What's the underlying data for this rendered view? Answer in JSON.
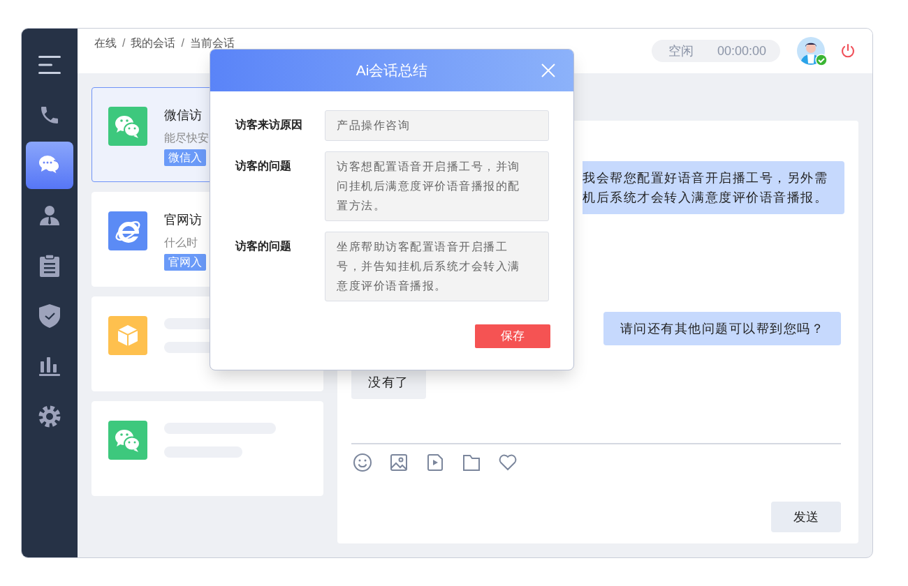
{
  "sidebar": {
    "items": [
      {
        "kind": "menu",
        "selected": false
      },
      {
        "kind": "phone",
        "selected": false
      },
      {
        "kind": "chat",
        "selected": true
      },
      {
        "kind": "person",
        "selected": false
      },
      {
        "kind": "clipboard",
        "selected": false
      },
      {
        "kind": "shield",
        "selected": false
      },
      {
        "kind": "chart",
        "selected": false
      },
      {
        "kind": "settings",
        "selected": false
      }
    ]
  },
  "breadcrumb": [
    {
      "kind": "link",
      "text": "在线"
    },
    {
      "kind": "separator",
      "text": "/"
    },
    {
      "kind": "link",
      "text": "我的会话"
    },
    {
      "kind": "separator",
      "text": "/"
    },
    {
      "kind": "link",
      "text": "当前会话"
    }
  ],
  "agent_status": {
    "state": "空闲",
    "timer": "00:00:00",
    "online": true
  },
  "sessions": [
    {
      "kind": "wechat",
      "title": "微信访",
      "preview": "能尽快安",
      "tag": "微信入",
      "selected": true
    },
    {
      "kind": "browser",
      "title": "官网访",
      "preview": "什么时",
      "tag": "官网入",
      "selected": false
    },
    {
      "kind": "package",
      "loading": true,
      "selected": false
    },
    {
      "kind": "wechat",
      "loading": true,
      "selected": false
    }
  ],
  "messages": [
    {
      "kind": "sent",
      "lines": [
        "我会帮您配置好语音开启播工号，另外需",
        "机后系统才会转入满意度评价语音播报。"
      ]
    },
    {
      "kind": "sent",
      "lines": [
        "请问还有其他问题可以帮到您吗？"
      ]
    },
    {
      "kind": "received",
      "lines": [
        "没有了"
      ]
    }
  ],
  "send_button": "发送",
  "modal": {
    "title": "Ai会话总结",
    "fields": [
      {
        "label": "访客来访原因",
        "lines": [
          "产品操作咨询"
        ]
      },
      {
        "label": "访客的问题",
        "lines": [
          "访客想配置语音开启播工号，并询",
          "问挂机后满意度评价语音播报的配",
          "置方法。"
        ]
      },
      {
        "label": "访客的问题",
        "lines": [
          "坐席帮助访客配置语音开启播工",
          "号，并告知挂机后系统才会转入满",
          "意度评价语音播报。"
        ]
      }
    ],
    "save_button": "保存"
  }
}
